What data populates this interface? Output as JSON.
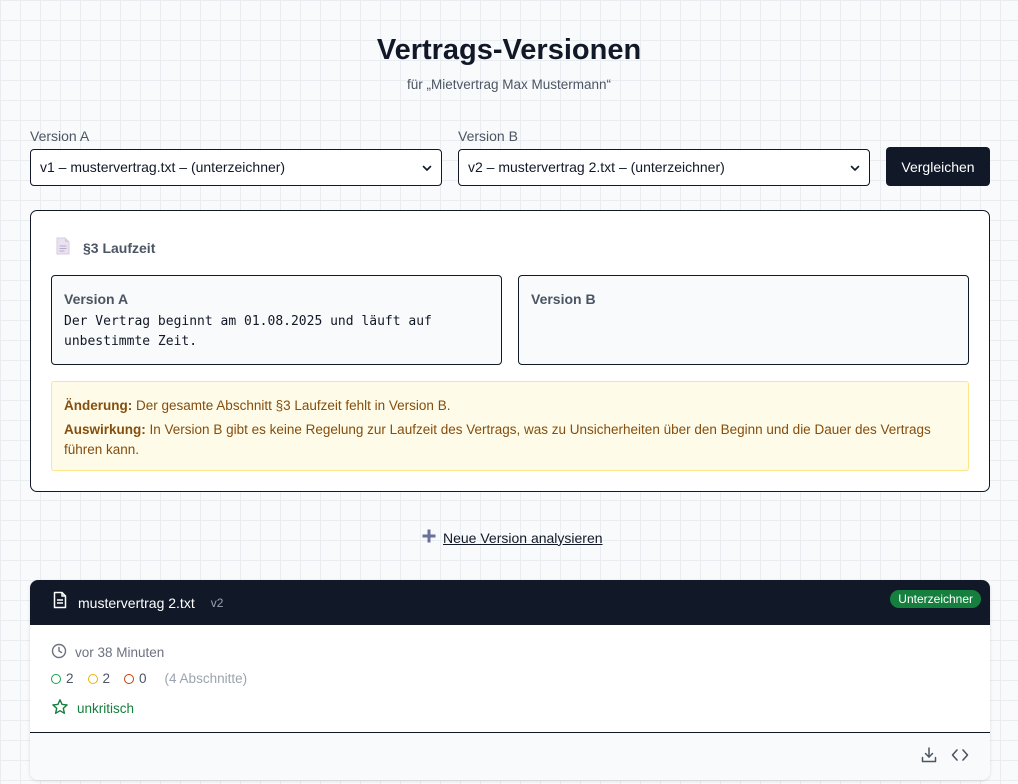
{
  "header": {
    "title": "Vertrags-Versionen",
    "subtitle": "für „Mietvertrag Max Mustermann“"
  },
  "compare": {
    "version_a_label": "Version A",
    "version_a_value": "v1 – mustervertrag.txt – (unterzeichner)",
    "version_b_label": "Version B",
    "version_b_value": "v2 – mustervertrag 2.txt – (unterzeichner)",
    "compare_button": "Vergleichen"
  },
  "section": {
    "title": "§3 Laufzeit",
    "version_a_title": "Version A",
    "version_a_text": "Der Vertrag beginnt am 01.08.2025 und läuft auf unbestimmte Zeit.",
    "version_b_title": "Version B",
    "version_b_text": "",
    "change_label": "Änderung:",
    "change_text": "Der gesamte Abschnitt §3 Laufzeit fehlt in Version B.",
    "impact_label": "Auswirkung:",
    "impact_text": "In Version B gibt es keine Regelung zur Laufzeit des Vertrags, was zu Unsicherheiten über den Beginn und die Dauer des Vertrags führen kann."
  },
  "new_version_link": "Neue Version analysieren",
  "version_card": {
    "filename": "mustervertrag 2.txt",
    "version_tag": "v2",
    "badge": "Unterzeichner",
    "time": "vor 38 Minuten",
    "stats": [
      {
        "count": "2",
        "color": "#16a34a"
      },
      {
        "count": "2",
        "color": "#eab308"
      },
      {
        "count": "0",
        "color": "#c2410c"
      }
    ],
    "sections_count": "(4 Abschnitte)",
    "criticality": "unkritisch"
  },
  "colors": {
    "primary_dark": "#111827",
    "success": "#15803d",
    "warning_bg": "#fefce8",
    "warning_text": "#854d0e"
  }
}
